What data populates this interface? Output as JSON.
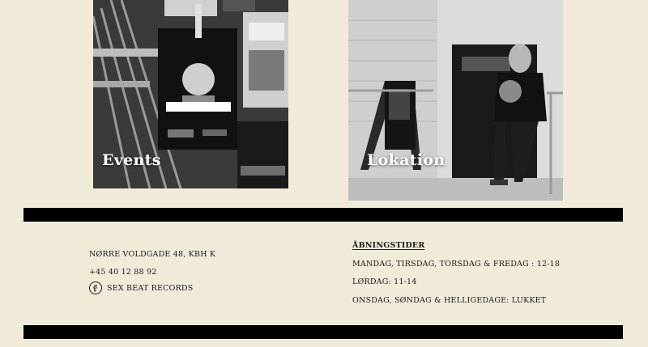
{
  "tiles": [
    {
      "title": "Events",
      "icon": "events-photo"
    },
    {
      "title": "Lokation",
      "icon": "storefront-photo"
    }
  ],
  "contact": {
    "address": "NØRRE VOLDGADE 48, KBH K",
    "phone": "+45 40 12 88 92",
    "social_label": "SEX BEAT RECORDS",
    "social_icon": "facebook-icon"
  },
  "hours": {
    "title": "ÅBNINGSTIDER",
    "lines": [
      "MANDAG, TIRSDAG, TORSDAG & FREDAG : 12-18",
      "LØRDAG: 11-14",
      "ONSDAG, SØNDAG & HELLIGEDAGE: LUKKET"
    ]
  },
  "colors": {
    "background": "#f0ead9",
    "bar": "#000000",
    "text": "#1a1a1a"
  }
}
